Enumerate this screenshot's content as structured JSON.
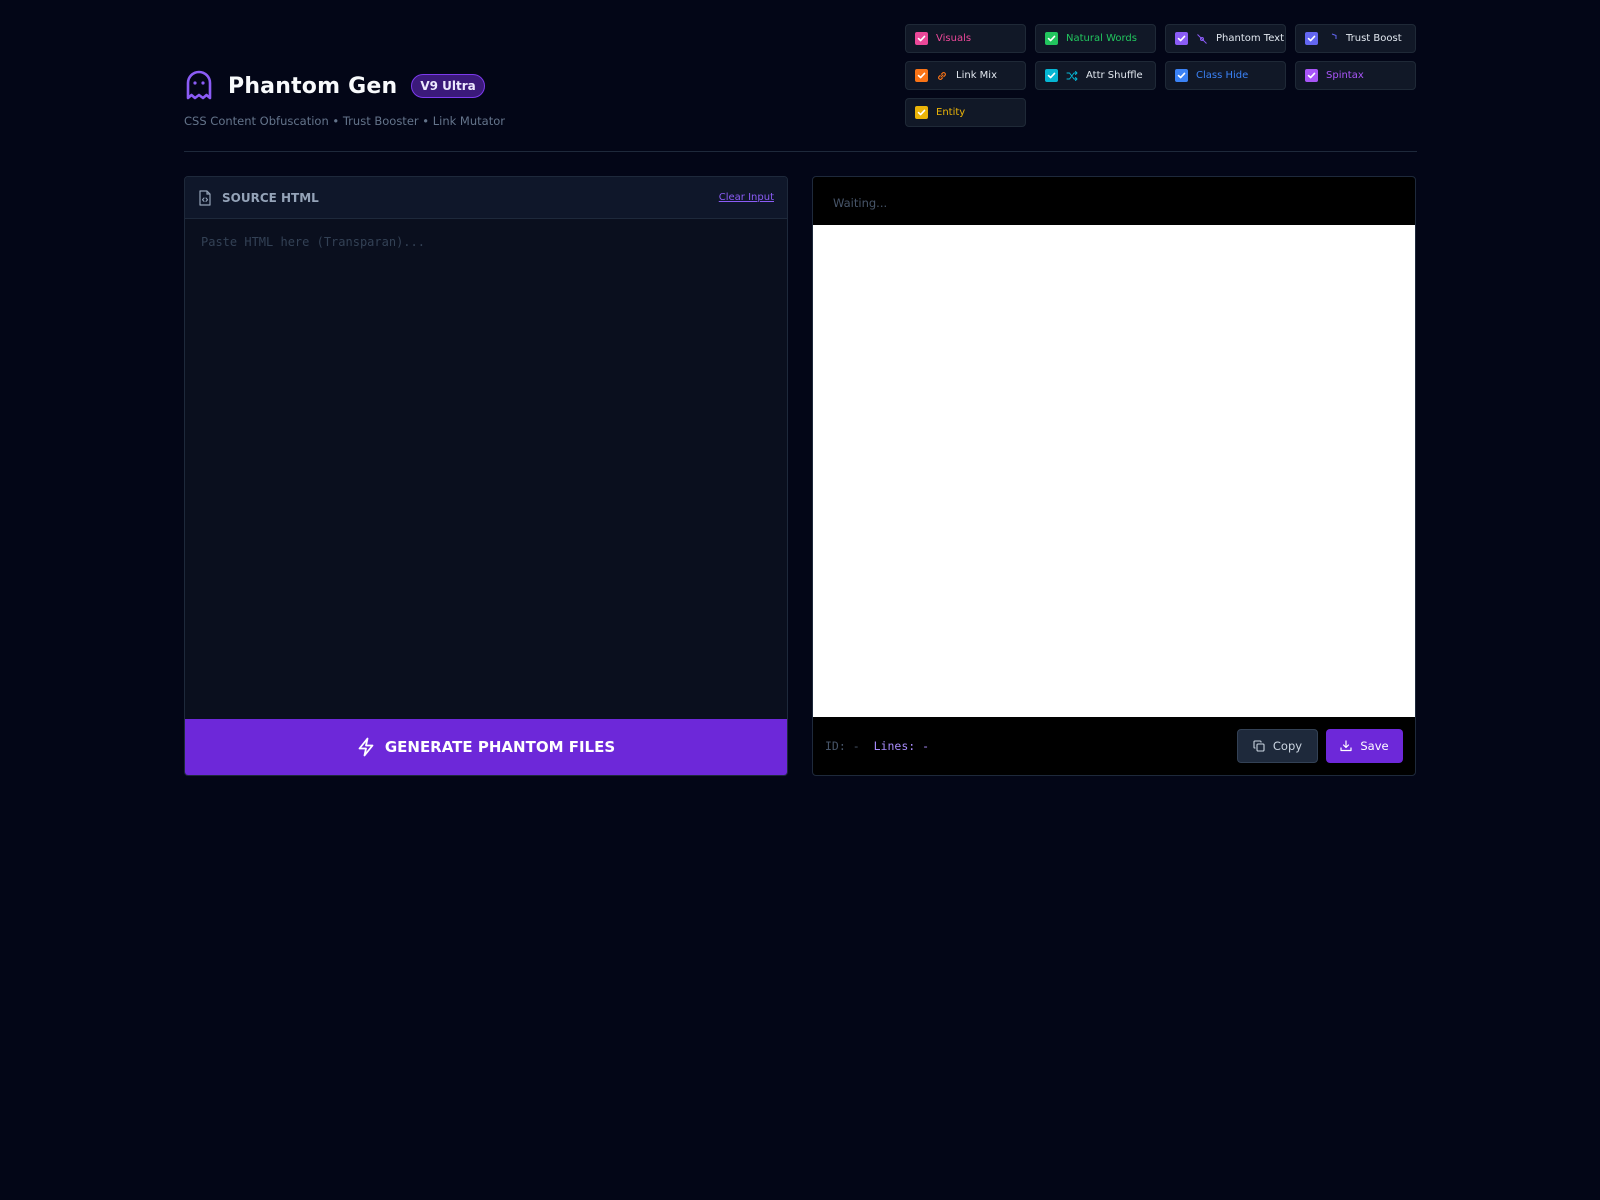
{
  "app": {
    "title": "Phantom Gen",
    "version_badge": "V9 Ultra",
    "subtitle": "CSS Content Obfuscation • Trust Booster • Link Mutator",
    "accent_color": "#6d28d9"
  },
  "options": [
    {
      "label": "Visuals",
      "checked": true,
      "color": "#ec4899",
      "icon": null
    },
    {
      "label": "Natural Words",
      "checked": true,
      "color": "#22c55e",
      "icon": null
    },
    {
      "label": "Phantom Text",
      "checked": true,
      "color": "#8b5cf6",
      "icon": "eye-off-icon"
    },
    {
      "label": "Trust Boost",
      "checked": true,
      "color": "#6366f1",
      "icon": "shield-icon"
    },
    {
      "label": "Link Mix",
      "checked": true,
      "color": "#f97316",
      "icon": "link-icon"
    },
    {
      "label": "Attr Shuffle",
      "checked": true,
      "color": "#06b6d4",
      "icon": "shuffle-icon"
    },
    {
      "label": "Class Hide",
      "checked": true,
      "color": "#3b82f6",
      "icon": null
    },
    {
      "label": "Spintax",
      "checked": true,
      "color": "#a855f7",
      "icon": null
    },
    {
      "label": "Entity",
      "checked": true,
      "color": "#eab308",
      "icon": null
    }
  ],
  "source_panel": {
    "title": "SOURCE HTML",
    "clear_label": "Clear Input",
    "placeholder": "Paste HTML here (Transparan)...",
    "value": "",
    "generate_label": "GENERATE PHANTOM FILES"
  },
  "output_panel": {
    "status": "Waiting...",
    "id_label": "ID: -",
    "lines_label": "Lines: -",
    "copy_label": "Copy",
    "save_label": "Save"
  }
}
